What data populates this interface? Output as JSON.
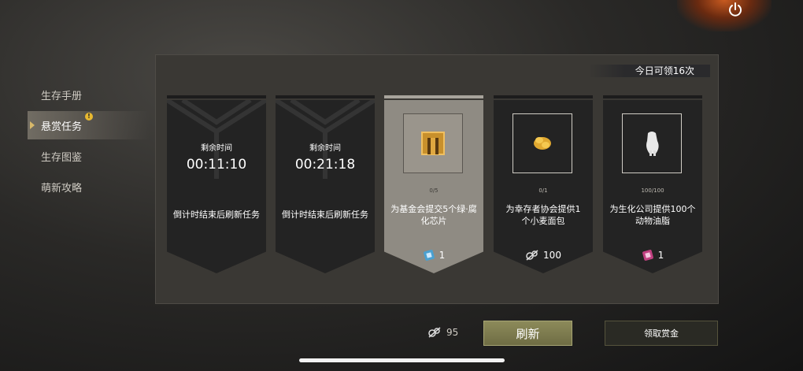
{
  "sidebar": {
    "items": [
      {
        "label": "生存手册",
        "active": false
      },
      {
        "label": "悬赏任务",
        "active": true,
        "badge": "!"
      },
      {
        "label": "生存图鉴",
        "active": false
      },
      {
        "label": "萌新攻略",
        "active": false
      }
    ]
  },
  "panel": {
    "daily_limit": "今日可领16次"
  },
  "cards": [
    {
      "type": "timer",
      "time_label": "剩余时间",
      "time": "00:11:10",
      "desc": "倒计时结束后刷新任务"
    },
    {
      "type": "timer",
      "time_label": "剩余时间",
      "time": "00:21:18",
      "desc": "倒计时结束后刷新任务"
    },
    {
      "type": "task",
      "progress": "0/5",
      "desc": "为基金会提交5个绿·腐化芯片",
      "reward_icon": "blue-chip-icon",
      "reward": "1"
    },
    {
      "type": "task",
      "progress": "0/1",
      "desc": "为幸存者协会提供1个小麦面包",
      "reward_icon": "scrap-parts-icon",
      "reward": "100"
    },
    {
      "type": "task",
      "progress": "100/100",
      "desc": "为生化公司提供100个动物油脂",
      "reward_icon": "pink-chip-icon",
      "reward": "1"
    }
  ],
  "footer": {
    "currency_count": "95",
    "refresh_label": "刷新",
    "claim_label": "领取赏金"
  },
  "colors": {
    "accent_gold": "#d8b86a",
    "refresh_green": "#7a784c",
    "panel_bg": "#3a3834"
  }
}
